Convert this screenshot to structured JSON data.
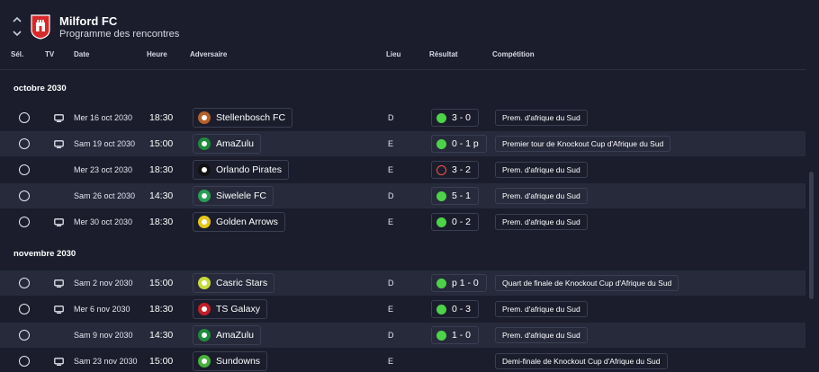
{
  "header": {
    "club_name": "Milford FC",
    "subtitle": "Programme des rencontres",
    "crest_color": "#d62a2a"
  },
  "columns": {
    "sel": "Sél.",
    "tv": "TV",
    "date": "Date",
    "time": "Heure",
    "opponent": "Adversaire",
    "venue": "Lieu",
    "result": "Résultat",
    "competition": "Compétition"
  },
  "months": [
    {
      "label": "octobre 2030"
    },
    {
      "label": "novembre 2030"
    }
  ],
  "fixtures": [
    {
      "tv": true,
      "date": "Mer 16 oct 2030",
      "time": "18:30",
      "opponent": "Stellenbosch FC",
      "badge": "#b5602a",
      "venue": "D",
      "result_type": "win",
      "score": "3 - 0",
      "competition": "Prem. d'afrique du Sud"
    },
    {
      "tv": true,
      "date": "Sam 19 oct 2030",
      "time": "15:00",
      "opponent": "AmaZulu",
      "badge": "#1f8a3c",
      "venue": "E",
      "result_type": "win",
      "score": "0 - 1 p",
      "competition": "Premier tour de Knockout Cup d'Afrique du Sud"
    },
    {
      "tv": false,
      "date": "Mer 23 oct 2030",
      "time": "18:30",
      "opponent": "Orlando Pirates",
      "badge": "#111111",
      "venue": "E",
      "result_type": "loss",
      "score": "3 - 2",
      "competition": "Prem. d'afrique du Sud"
    },
    {
      "tv": false,
      "date": "Sam 26 oct 2030",
      "time": "14:30",
      "opponent": "Siwelele FC",
      "badge": "#2a9d55",
      "venue": "D",
      "result_type": "win",
      "score": "5 - 1",
      "competition": "Prem. d'afrique du Sud"
    },
    {
      "tv": true,
      "date": "Mer 30 oct 2030",
      "time": "18:30",
      "opponent": "Golden Arrows",
      "badge": "#e3c61a",
      "venue": "E",
      "result_type": "win",
      "score": "0 - 2",
      "competition": "Prem. d'afrique du Sud"
    },
    {
      "tv": true,
      "date": "Sam 2 nov 2030",
      "time": "15:00",
      "opponent": "Casric Stars",
      "badge": "#c8d93a",
      "venue": "D",
      "result_type": "win",
      "score": "p 1 - 0",
      "competition": "Quart de finale de Knockout Cup d'Afrique du Sud"
    },
    {
      "tv": true,
      "date": "Mer 6 nov 2030",
      "time": "18:30",
      "opponent": "TS Galaxy",
      "badge": "#c41e2a",
      "venue": "E",
      "result_type": "win",
      "score": "0 - 3",
      "competition": "Prem. d'afrique du Sud"
    },
    {
      "tv": false,
      "date": "Sam 9 nov 2030",
      "time": "14:30",
      "opponent": "AmaZulu",
      "badge": "#1f8a3c",
      "venue": "D",
      "result_type": "win",
      "score": "1 - 0",
      "competition": "Prem. d'afrique du Sud"
    },
    {
      "tv": true,
      "date": "Sam 23 nov 2030",
      "time": "15:00",
      "opponent": "Sundowns",
      "badge": "#48b03c",
      "venue": "E",
      "result_type": "none",
      "score": "",
      "competition": "Demi-finale de Knockout Cup d'Afrique du Sud"
    }
  ],
  "colors": {
    "background": "#1b1d2c",
    "row_alt": "#262a3b",
    "win": "#4ed24a",
    "loss": "#f0584a"
  }
}
